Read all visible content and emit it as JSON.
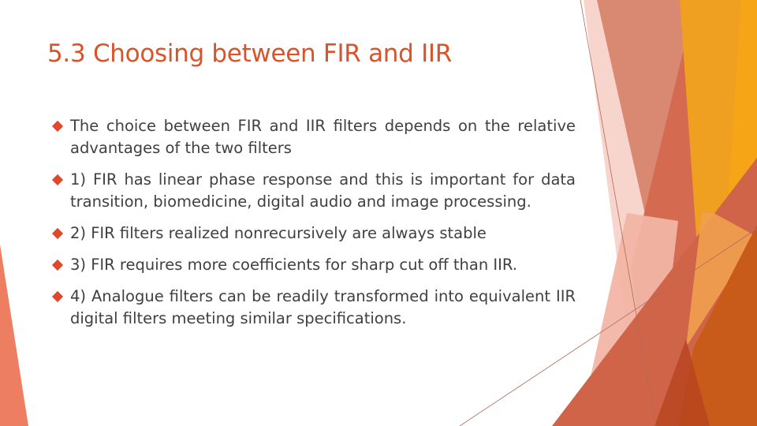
{
  "slide": {
    "title": "5.3 Choosing between FIR and IIR",
    "bullets": [
      "The choice between FIR and IIR filters depends on the relative advantages of the two filters",
      "1) FIR has linear phase response and this is important for data transition, biomedicine, digital audio and image processing.",
      "2) FIR filters realized nonrecursively are always stable",
      "3) FIR requires more coefficients for sharp cut off than IIR.",
      "4) Analogue filters can be readily transformed into equivalent IIR digital filters meeting similar specifications."
    ],
    "bullet_icon": "diamond-bullet",
    "colors": {
      "title": "#d9532b",
      "body_text": "#404040",
      "bullet": "#e0482a",
      "accent_orange": "#f29c1b",
      "accent_dark_orange": "#c85a1a",
      "accent_salmon": "#d98872",
      "accent_coral": "#d46a50",
      "accent_pink": "#f2b5a5"
    }
  }
}
